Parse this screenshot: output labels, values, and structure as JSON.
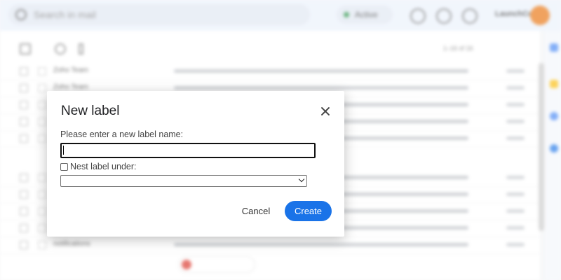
{
  "background": {
    "search_placeholder": "Search in mail",
    "status_label": "Active",
    "org_name": "LaunchCodes",
    "pagination": "1–16 of 16",
    "rows": [
      {
        "sender": "Zoho Team"
      },
      {
        "sender": "Zoho Team"
      },
      {
        "sender": ""
      },
      {
        "sender": ""
      },
      {
        "sender": ""
      },
      {
        "sender": ""
      },
      {
        "sender": ""
      },
      {
        "sender": ""
      },
      {
        "sender": ""
      },
      {
        "sender": "notifications"
      }
    ]
  },
  "dialog": {
    "title": "New label",
    "prompt": "Please enter a new label name:",
    "name_value": "",
    "nest_label": "Nest label under:",
    "nest_checked": false,
    "parent_value": "",
    "cancel_label": "Cancel",
    "create_label": "Create",
    "accent_color": "#1a73e8"
  }
}
